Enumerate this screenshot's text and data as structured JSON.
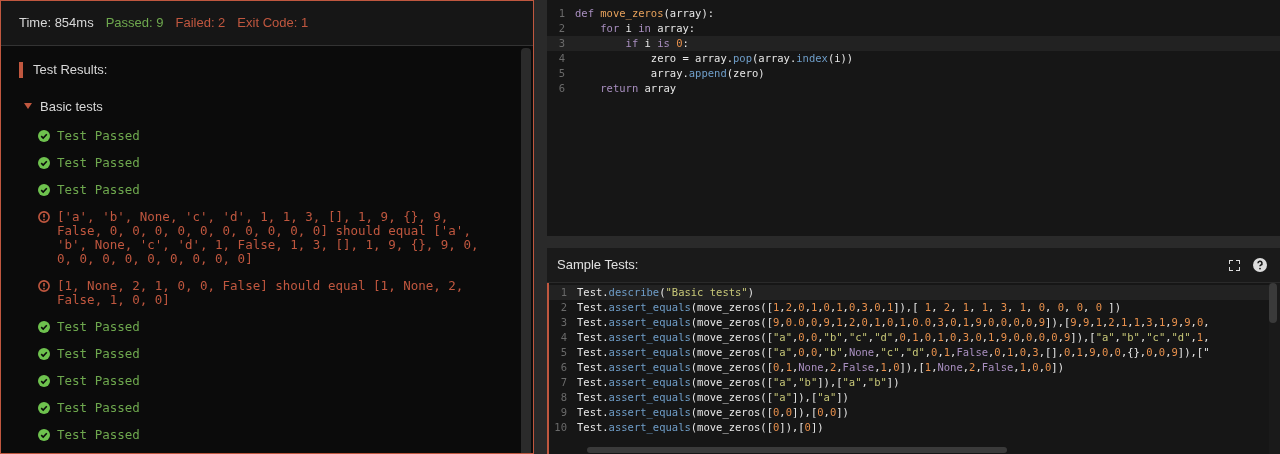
{
  "summary": {
    "time": "Time: 854ms",
    "passed": "Passed: 9",
    "failed": "Failed: 2",
    "exit_code": "Exit Code: 1"
  },
  "results_title": "Test Results:",
  "group": {
    "label": "Basic tests",
    "expanded": true,
    "results": [
      {
        "kind": "passed",
        "text": "Test Passed"
      },
      {
        "kind": "passed",
        "text": "Test Passed"
      },
      {
        "kind": "passed",
        "text": "Test Passed"
      },
      {
        "kind": "failed",
        "text": "['a', 'b', None, 'c', 'd', 1, 1, 3, [], 1, 9, {}, 9, False, 0, 0, 0, 0, 0, 0, 0, 0, 0, 0] should equal ['a', 'b', None, 'c', 'd', 1, False, 1, 3, [], 1, 9, {}, 9, 0, 0, 0, 0, 0, 0, 0, 0, 0, 0]"
      },
      {
        "kind": "failed",
        "text": "[1, None, 2, 1, 0, 0, False] should equal [1, None, 2, False, 1, 0, 0]"
      },
      {
        "kind": "passed",
        "text": "Test Passed"
      },
      {
        "kind": "passed",
        "text": "Test Passed"
      },
      {
        "kind": "passed",
        "text": "Test Passed"
      },
      {
        "kind": "passed",
        "text": "Test Passed"
      },
      {
        "kind": "passed",
        "text": "Test Passed"
      }
    ]
  },
  "solution_editor": {
    "lines": [
      {
        "number": "1",
        "current": false,
        "segments": [
          {
            "kind": "keyword",
            "text": "def "
          },
          {
            "kind": "function",
            "text": "move_zeros"
          },
          {
            "kind": "plain",
            "text": "(array):"
          }
        ]
      },
      {
        "number": "2",
        "current": false,
        "segments": [
          {
            "kind": "keyword",
            "text": "    for "
          },
          {
            "kind": "plain",
            "text": "i "
          },
          {
            "kind": "keyword",
            "text": "in "
          },
          {
            "kind": "plain",
            "text": "array:"
          }
        ]
      },
      {
        "number": "3",
        "current": true,
        "segments": [
          {
            "kind": "keyword",
            "text": "        if "
          },
          {
            "kind": "plain",
            "text": "i "
          },
          {
            "kind": "keyword",
            "text": "is "
          },
          {
            "kind": "plain",
            "text": "0:"
          }
        ]
      },
      {
        "number": "4",
        "current": false,
        "segments": [
          {
            "kind": "plain",
            "text": "            zero = array."
          },
          {
            "kind": "method",
            "text": "pop"
          },
          {
            "kind": "plain",
            "text": "(array."
          },
          {
            "kind": "method",
            "text": "index"
          },
          {
            "kind": "plain",
            "text": "(i))"
          }
        ]
      },
      {
        "number": "5",
        "current": false,
        "segments": [
          {
            "kind": "plain",
            "text": "            array."
          },
          {
            "kind": "method",
            "text": "append"
          },
          {
            "kind": "plain",
            "text": "(zero)"
          }
        ]
      },
      {
        "number": "6",
        "current": false,
        "segments": [
          {
            "kind": "keyword",
            "text": "    return "
          },
          {
            "kind": "plain",
            "text": "array"
          }
        ]
      }
    ]
  },
  "sample_tests": {
    "title": "Sample Tests:",
    "lines": [
      {
        "number": "1",
        "current": true,
        "segments": [
          {
            "kind": "plain",
            "text": "Test."
          },
          {
            "kind": "method",
            "text": "describe"
          },
          {
            "kind": "plain",
            "text": "(\"Basic tests\")"
          }
        ]
      },
      {
        "number": "2",
        "current": false,
        "segments": [
          {
            "kind": "plain",
            "text": "Test."
          },
          {
            "kind": "method",
            "text": "assert_equals"
          },
          {
            "kind": "plain",
            "text": "(move_zeros([1,2,0,1,0,1,0,3,0,1]),[ 1, 2, 1, 1, 3, 1, 0, 0, 0, 0 ])"
          }
        ]
      },
      {
        "number": "3",
        "current": false,
        "segments": [
          {
            "kind": "plain",
            "text": "Test."
          },
          {
            "kind": "method",
            "text": "assert_equals"
          },
          {
            "kind": "plain",
            "text": "(move_zeros([9,0.0,0,9,1,2,0,1,0,1,0.0,3,0,1,9,0,0,0,0,9]),[9,9,1,2,1,1,3,1,9,9,0,"
          }
        ]
      },
      {
        "number": "4",
        "current": false,
        "segments": [
          {
            "kind": "plain",
            "text": "Test."
          },
          {
            "kind": "method",
            "text": "assert_equals"
          },
          {
            "kind": "plain",
            "text": "(move_zeros([\"a\",0,0,\"b\",\"c\",\"d\",0,1,0,1,0,3,0,1,9,0,0,0,0,9]),[\"a\",\"b\",\"c\",\"d\",1,"
          }
        ]
      },
      {
        "number": "5",
        "current": false,
        "segments": [
          {
            "kind": "plain",
            "text": "Test."
          },
          {
            "kind": "method",
            "text": "assert_equals"
          },
          {
            "kind": "plain",
            "text": "(move_zeros([\"a\",0,0,\"b\","
          },
          {
            "kind": "constant",
            "text": "None"
          },
          {
            "kind": "plain",
            "text": ",\"c\",\"d\",0,1,"
          },
          {
            "kind": "constant",
            "text": "False"
          },
          {
            "kind": "plain",
            "text": ",0,1,0,3,[],0,1,9,0,0,{},0,0,9]),[\""
          }
        ]
      },
      {
        "number": "6",
        "current": false,
        "segments": [
          {
            "kind": "plain",
            "text": "Test."
          },
          {
            "kind": "method",
            "text": "assert_equals"
          },
          {
            "kind": "plain",
            "text": "(move_zeros([0,1,"
          },
          {
            "kind": "constant",
            "text": "None"
          },
          {
            "kind": "plain",
            "text": ",2,"
          },
          {
            "kind": "constant",
            "text": "False"
          },
          {
            "kind": "plain",
            "text": ",1,0]),[1,"
          },
          {
            "kind": "constant",
            "text": "None"
          },
          {
            "kind": "plain",
            "text": ",2,"
          },
          {
            "kind": "constant",
            "text": "False"
          },
          {
            "kind": "plain",
            "text": ",1,0,0])"
          }
        ]
      },
      {
        "number": "7",
        "current": false,
        "segments": [
          {
            "kind": "plain",
            "text": "Test."
          },
          {
            "kind": "method",
            "text": "assert_equals"
          },
          {
            "kind": "plain",
            "text": "(move_zeros([\"a\",\"b\"]),[\"a\",\"b\"])"
          }
        ]
      },
      {
        "number": "8",
        "current": false,
        "segments": [
          {
            "kind": "plain",
            "text": "Test."
          },
          {
            "kind": "method",
            "text": "assert_equals"
          },
          {
            "kind": "plain",
            "text": "(move_zeros([\"a\"]),[\"a\"])"
          }
        ]
      },
      {
        "number": "9",
        "current": false,
        "segments": [
          {
            "kind": "plain",
            "text": "Test."
          },
          {
            "kind": "method",
            "text": "assert_equals"
          },
          {
            "kind": "plain",
            "text": "(move_zeros([0,0]),[0,0])"
          }
        ]
      },
      {
        "number": "10",
        "current": false,
        "segments": [
          {
            "kind": "plain",
            "text": "Test."
          },
          {
            "kind": "method",
            "text": "assert_equals"
          },
          {
            "kind": "plain",
            "text": "(move_zeros([0]),[0])"
          }
        ]
      }
    ]
  }
}
